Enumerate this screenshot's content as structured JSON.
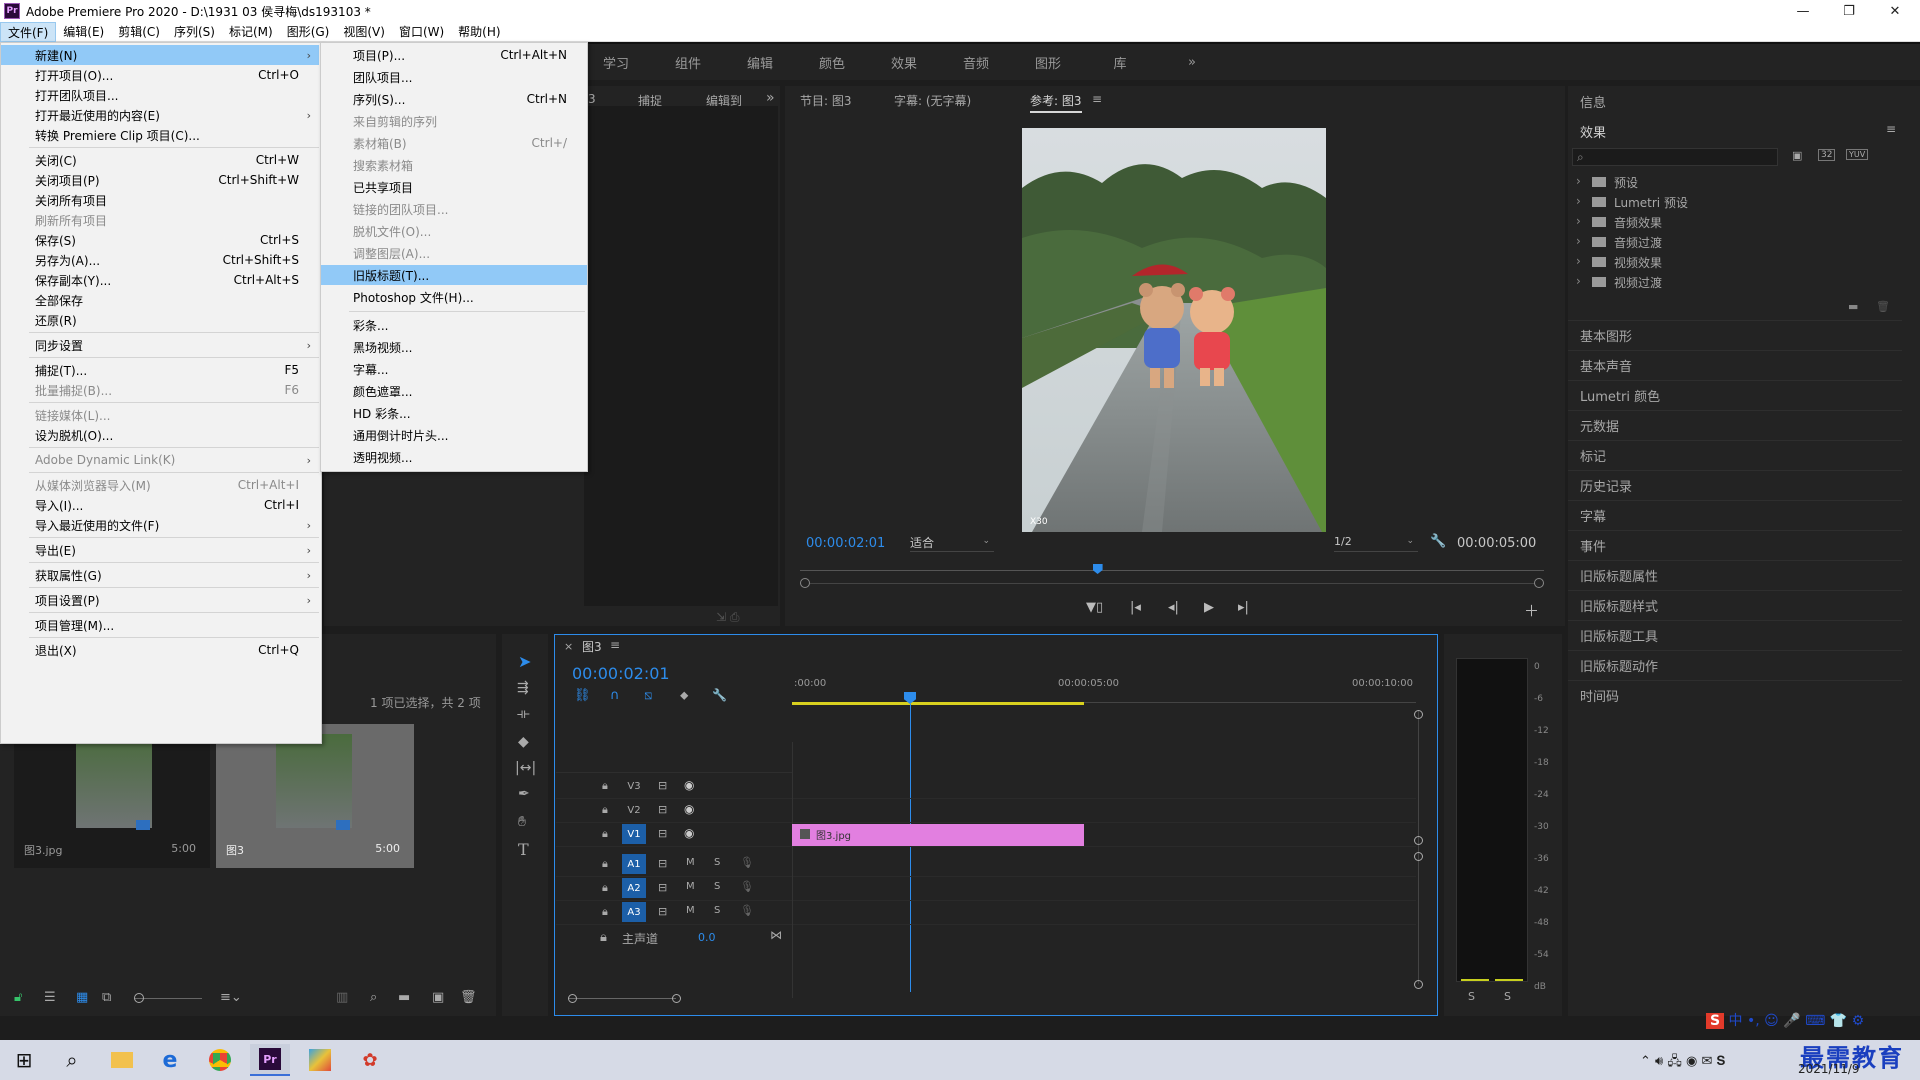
{
  "app": {
    "title": "Adobe Premiere Pro 2020 - D:\\1931 03 侯寻梅\\ds193103 *",
    "logo": "Pr",
    "minimize": "—",
    "maximize": "❐",
    "close": "✕"
  },
  "menubar": [
    "文件(F)",
    "编辑(E)",
    "剪辑(C)",
    "序列(S)",
    "标记(M)",
    "图形(G)",
    "视图(V)",
    "窗口(W)",
    "帮助(H)"
  ],
  "workspaces": [
    "学习",
    "组件",
    "编辑",
    "颜色",
    "效果",
    "音频",
    "图形",
    "库",
    "»"
  ],
  "file_menu": [
    {
      "label": "新建(N)",
      "shortcut": "",
      "submenu": true,
      "state": "selected"
    },
    {
      "label": "打开项目(O)...",
      "shortcut": "Ctrl+O",
      "submenu": false,
      "state": "normal"
    },
    {
      "label": "打开团队项目...",
      "shortcut": "",
      "submenu": false,
      "state": "normal"
    },
    {
      "label": "打开最近使用的内容(E)",
      "shortcut": "",
      "submenu": true,
      "state": "normal"
    },
    {
      "label": "转换 Premiere Clip 项目(C)...",
      "shortcut": "",
      "submenu": false,
      "state": "normal"
    },
    {
      "sep": true
    },
    {
      "label": "关闭(C)",
      "shortcut": "Ctrl+W",
      "submenu": false,
      "state": "normal"
    },
    {
      "label": "关闭项目(P)",
      "shortcut": "Ctrl+Shift+W",
      "submenu": false,
      "state": "normal"
    },
    {
      "label": "关闭所有项目",
      "shortcut": "",
      "submenu": false,
      "state": "normal"
    },
    {
      "label": "刷新所有项目",
      "shortcut": "",
      "submenu": false,
      "state": "disabled"
    },
    {
      "label": "保存(S)",
      "shortcut": "Ctrl+S",
      "submenu": false,
      "state": "normal"
    },
    {
      "label": "另存为(A)...",
      "shortcut": "Ctrl+Shift+S",
      "submenu": false,
      "state": "normal"
    },
    {
      "label": "保存副本(Y)...",
      "shortcut": "Ctrl+Alt+S",
      "submenu": false,
      "state": "normal"
    },
    {
      "label": "全部保存",
      "shortcut": "",
      "submenu": false,
      "state": "normal"
    },
    {
      "label": "还原(R)",
      "shortcut": "",
      "submenu": false,
      "state": "normal"
    },
    {
      "sep": true
    },
    {
      "label": "同步设置",
      "shortcut": "",
      "submenu": true,
      "state": "normal"
    },
    {
      "sep": true
    },
    {
      "label": "捕捉(T)...",
      "shortcut": "F5",
      "submenu": false,
      "state": "normal"
    },
    {
      "label": "批量捕捉(B)...",
      "shortcut": "F6",
      "submenu": false,
      "state": "disabled"
    },
    {
      "sep": true
    },
    {
      "label": "链接媒体(L)...",
      "shortcut": "",
      "submenu": false,
      "state": "disabled"
    },
    {
      "label": "设为脱机(O)...",
      "shortcut": "",
      "submenu": false,
      "state": "normal"
    },
    {
      "sep": true
    },
    {
      "label": "Adobe Dynamic Link(K)",
      "shortcut": "",
      "submenu": true,
      "state": "disabled"
    },
    {
      "sep": true
    },
    {
      "label": "从媒体浏览器导入(M)",
      "shortcut": "Ctrl+Alt+I",
      "submenu": false,
      "state": "disabled"
    },
    {
      "label": "导入(I)...",
      "shortcut": "Ctrl+I",
      "submenu": false,
      "state": "normal"
    },
    {
      "label": "导入最近使用的文件(F)",
      "shortcut": "",
      "submenu": true,
      "state": "normal"
    },
    {
      "sep": true
    },
    {
      "label": "导出(E)",
      "shortcut": "",
      "submenu": true,
      "state": "normal"
    },
    {
      "sep": true
    },
    {
      "label": "获取属性(G)",
      "shortcut": "",
      "submenu": true,
      "state": "normal"
    },
    {
      "sep": true
    },
    {
      "label": "项目设置(P)",
      "shortcut": "",
      "submenu": true,
      "state": "normal"
    },
    {
      "sep": true
    },
    {
      "label": "项目管理(M)...",
      "shortcut": "",
      "submenu": false,
      "state": "normal"
    },
    {
      "sep": true
    },
    {
      "label": "退出(X)",
      "shortcut": "Ctrl+Q",
      "submenu": false,
      "state": "normal"
    }
  ],
  "new_submenu": [
    {
      "label": "项目(P)...",
      "shortcut": "Ctrl+Alt+N",
      "state": "normal"
    },
    {
      "label": "团队项目...",
      "shortcut": "",
      "state": "normal"
    },
    {
      "label": "序列(S)...",
      "shortcut": "Ctrl+N",
      "state": "normal"
    },
    {
      "label": "来自剪辑的序列",
      "shortcut": "",
      "state": "disabled"
    },
    {
      "label": "素材箱(B)",
      "shortcut": "Ctrl+/",
      "state": "disabled"
    },
    {
      "label": "搜索素材箱",
      "shortcut": "",
      "state": "disabled"
    },
    {
      "label": "已共享项目",
      "shortcut": "",
      "state": "normal"
    },
    {
      "label": "链接的团队项目...",
      "shortcut": "",
      "state": "disabled"
    },
    {
      "label": "脱机文件(O)...",
      "shortcut": "",
      "state": "disabled"
    },
    {
      "label": "调整图层(A)...",
      "shortcut": "",
      "state": "disabled"
    },
    {
      "label": "旧版标题(T)...",
      "shortcut": "",
      "state": "selected"
    },
    {
      "label": "Photoshop 文件(H)...",
      "shortcut": "",
      "state": "normal"
    },
    {
      "sep": true
    },
    {
      "label": "彩条...",
      "shortcut": "",
      "state": "normal"
    },
    {
      "label": "黑场视频...",
      "shortcut": "",
      "state": "normal"
    },
    {
      "label": "字幕...",
      "shortcut": "",
      "state": "normal"
    },
    {
      "label": "颜色遮罩...",
      "shortcut": "",
      "state": "normal"
    },
    {
      "label": "HD 彩条...",
      "shortcut": "",
      "state": "normal"
    },
    {
      "label": "通用倒计时片头...",
      "shortcut": "",
      "state": "normal"
    },
    {
      "label": "透明视频...",
      "shortcut": "",
      "state": "normal"
    }
  ],
  "source_tabs": [
    "3",
    "捕捉",
    "编辑到",
    "»"
  ],
  "program": {
    "tabs": [
      "节目: 图3",
      "字幕: (无字幕)",
      "参考: 图3"
    ],
    "menu_icon": "≡",
    "timecode": "00:00:02:01",
    "fit": "适合",
    "resolution": "1/2",
    "duration": "00:00:05:00",
    "playhead_fraction": 0.4,
    "watermark": "X30"
  },
  "project": {
    "status": "1 项已选择，共 2 项",
    "items": [
      {
        "name": "图3.jpg",
        "duration": "5:00"
      },
      {
        "name": "图3",
        "duration": "5:00"
      }
    ]
  },
  "timeline": {
    "tab": "图3",
    "close": "×",
    "menu_icon": "≡",
    "timecode": "00:00:02:01",
    "ruler": [
      ":00:00",
      "00:00:05:00",
      "00:00:10:00"
    ],
    "tracks_video": [
      "V3",
      "V2",
      "V1"
    ],
    "tracks_audio": [
      "A1",
      "A2",
      "A3"
    ],
    "master_label": "主声道",
    "master_value": "0.0",
    "clip_name": "图3.jpg",
    "clip_color": "#e27fe0",
    "track_m": "M",
    "track_s": "S"
  },
  "meter": {
    "scale": [
      "0",
      "-6",
      "-12",
      "-18",
      "-24",
      "-30",
      "-36",
      "-42",
      "-48",
      "-54",
      "dB"
    ],
    "solo": [
      "S",
      "S"
    ]
  },
  "right_panel": {
    "info": "信息",
    "effects": "效果",
    "effects_menu": "≡",
    "folders": [
      "预设",
      "Lumetri 预设",
      "音频效果",
      "音频过渡",
      "视频效果",
      "视频过渡"
    ],
    "sections": [
      "基本图形",
      "基本声音",
      "Lumetri 颜色",
      "元数据",
      "标记",
      "历史记录",
      "字幕",
      "事件",
      "旧版标题属性",
      "旧版标题样式",
      "旧版标题工具",
      "旧版标题动作",
      "时间码"
    ],
    "btn_32": "32",
    "btn_yuv": "YUV"
  },
  "taskbar": {
    "date": "2021/11/9",
    "watermark": "最需教育",
    "ime": "中"
  },
  "colors": {
    "accent": "#2d8ceb",
    "menu_select": "#91c9f7",
    "clip": "#e27fe0",
    "timecode": "#2d8ceb"
  }
}
